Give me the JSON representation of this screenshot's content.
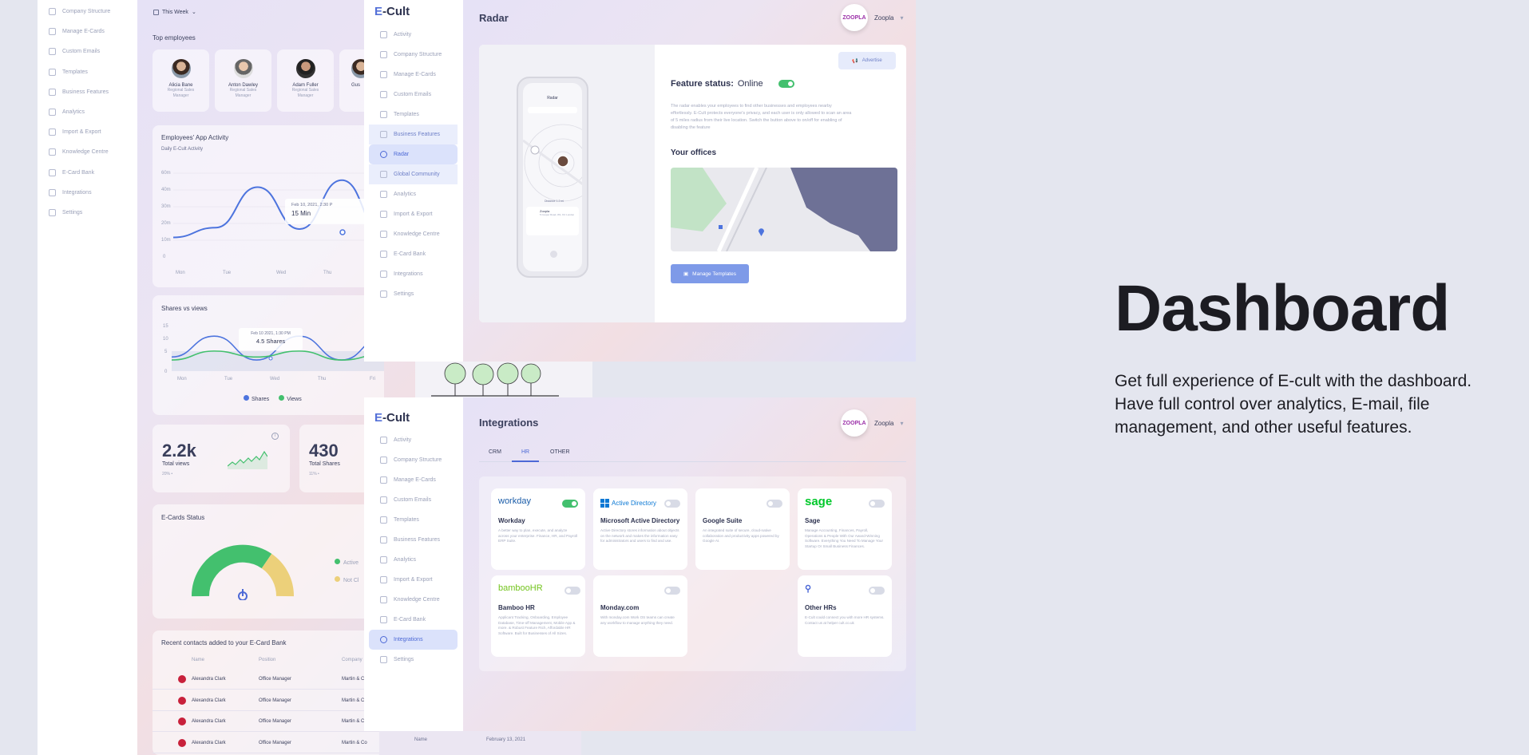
{
  "back_sidebar": {
    "items": [
      "Company Structure",
      "Manage E-Cards",
      "Custom Emails",
      "Templates",
      "Business Features",
      "Analytics",
      "Import & Export",
      "Knowledge Centre",
      "E-Card Bank",
      "Integrations",
      "Settings"
    ]
  },
  "back_dashboard": {
    "period": "This Week",
    "top_employees_title": "Top employees",
    "employees": [
      {
        "name": "Alicia Bane",
        "role": "Regional Sales Manager"
      },
      {
        "name": "Anton Dawley",
        "role": "Regional Sales Manager"
      },
      {
        "name": "Adam Fuller",
        "role": "Regional Sales Manager"
      },
      {
        "name": "Gus",
        "role": ""
      }
    ],
    "activity_title": "Employees' App Activity",
    "activity_subtitle": "Daily E-Cult Activity",
    "activity_tooltip_date": "Feb 10, 2021, 2:30 P",
    "activity_tooltip_value": "15 Min",
    "shares_title": "Shares vs views",
    "shares_tooltip_date": "Feb 10 2021, 1:30 PM",
    "shares_tooltip_value": "4.5 Shares",
    "legend_shares": "Shares",
    "legend_views": "Views",
    "stat1_value": "2.2k",
    "stat1_label": "Total views",
    "stat1_change": "20% •",
    "stat2_value": "430",
    "stat2_label": "Total Shares",
    "stat2_change": "11% •",
    "ecards_title": "E-Cards Status",
    "ecards_active": "Active",
    "ecards_not": "Not Cl",
    "recent_title": "Recent contacts added to your E-Card Bank",
    "recent_cols": [
      "Name",
      "Position",
      "Company"
    ],
    "recent_rows": [
      {
        "name": "Alexandra Clark",
        "position": "Office Manager",
        "company": "Martin & C"
      },
      {
        "name": "Alexandra Clark",
        "position": "Office Manager",
        "company": "Martin & C"
      },
      {
        "name": "Alexandra Clark",
        "position": "Office Manager",
        "company": "Martin & C"
      },
      {
        "name": "Alexandra Clark",
        "position": "Office Manager",
        "company": "Martin & Co"
      }
    ],
    "bottom_name": "Name",
    "bottom_date": "February 13, 2021"
  },
  "chart_data": [
    {
      "type": "line",
      "title": "Employees' App Activity",
      "subtitle": "Daily E-Cult Activity",
      "categories": [
        "Mon",
        "Tue",
        "Wed",
        "Thu"
      ],
      "y_ticks": [
        "60m",
        "40m",
        "30m",
        "20m",
        "10m",
        "0"
      ],
      "series": [
        {
          "name": "",
          "values": [
            14,
            21,
            50,
            20,
            55,
            15
          ]
        }
      ]
    },
    {
      "type": "line",
      "title": "Shares vs views",
      "categories": [
        "Mon",
        "Tue",
        "Wed",
        "Thu",
        "Fri"
      ],
      "y_ticks": [
        "15",
        "10",
        "5",
        "0"
      ],
      "series": [
        {
          "name": "Shares",
          "values": [
            5,
            12,
            4,
            12,
            4,
            12
          ]
        },
        {
          "name": "Views",
          "values": [
            4,
            7,
            5,
            7,
            4,
            6
          ]
        }
      ]
    }
  ],
  "app": {
    "logo_e": "E",
    "logo_rest": "-Cult",
    "brand_logo": "ZOOPLA",
    "brand_name": "Zoopla"
  },
  "radar_window": {
    "sidebar": [
      "Activity",
      "Company Structure",
      "Manage E-Cards",
      "Custom Emails",
      "Templates",
      "Business Features",
      "Radar",
      "Global Community",
      "Analytics",
      "Import & Export",
      "Knowledge Centre",
      "E-Card Bank",
      "Integrations",
      "Settings"
    ],
    "title": "Radar",
    "advertise": "Advertise",
    "feature_status_label": "Feature status:",
    "feature_status_value": "Online",
    "description": "The radar enables your employees to find other businesses and employees nearby effortlessly. E-Cult protects everyone's privacy, and each user is only allowed to scan an area of 5 miles radius from their live location. Switch the button above to on/off for enabling of disabling the feature",
    "offices_title": "Your offices",
    "manage_templates": "Manage Templates",
    "phone": {
      "title": "Radar",
      "distance": "Distance 1.2 mi",
      "company": "Zoopla",
      "address": "5 Cooper Road, W1, KU London",
      "time": "3:1pm"
    }
  },
  "integrations_window": {
    "sidebar": [
      "Activity",
      "Company Structure",
      "Manage E-Cards",
      "Custom Emails",
      "Templates",
      "Business Features",
      "Analytics",
      "Import & Export",
      "Knowledge Centre",
      "E-Card Bank",
      "Integrations",
      "Settings"
    ],
    "title": "Integrations",
    "tabs": [
      "CRM",
      "HR",
      "OTHER"
    ],
    "active_tab": "HR",
    "cards": [
      {
        "logo": "workday",
        "name": "Workday",
        "on": true,
        "desc": "A better way to plan, execute, and analyze across your enterprise. Finance, HR, and Payroll ERP Suite."
      },
      {
        "logo": "Active Directory",
        "name": "Microsoft Active Directory",
        "on": false,
        "desc": "Active Directory stores information about objects on the network and makes the information easy for administrators and users to find and use."
      },
      {
        "logo": "",
        "name": "Google Suite",
        "on": false,
        "desc": "An integrated suite of secure, cloud-native collaboration and productivity apps powered by Google AI."
      },
      {
        "logo": "sage",
        "name": "Sage",
        "on": false,
        "desc": "Manage Accounting, Finances, Payroll, Operations & People With Our Award-Winning Software. Everything You Need To Manage Your Startup Or Small Business Finances."
      },
      {
        "logo": "bambooHR",
        "name": "Bamboo HR",
        "on": false,
        "desc": "Applicant Tracking, Onboarding, Employee Database, Time-off Management, Mobile App & more. & Robust Feature Rich, Affordable HR Software. Built for Businesses of All Sizes."
      },
      {
        "logo": "",
        "name": "Monday.com",
        "on": false,
        "desc": "With monday.com Work OS teams can create any workflow to manage anything they need."
      },
      {
        "logo": "",
        "name": "Other HRs",
        "on": false,
        "desc": "E-Cult could connect you with more HR systems. Contact us at helper cult.co.uk"
      }
    ]
  },
  "promo": {
    "heading": "Dashboard",
    "text": "Get full experience of E-cult with the dashboard. Have full control over analytics, E-mail, file management, and other useful features."
  },
  "colors": {
    "accent": "#5470d8",
    "toggle_on": "#43c06e",
    "line_blue": "#4d74de",
    "line_green": "#43c06e",
    "gauge_green": "#43c06e",
    "gauge_yellow": "#ecd07a",
    "map_water": "#6e7196"
  }
}
